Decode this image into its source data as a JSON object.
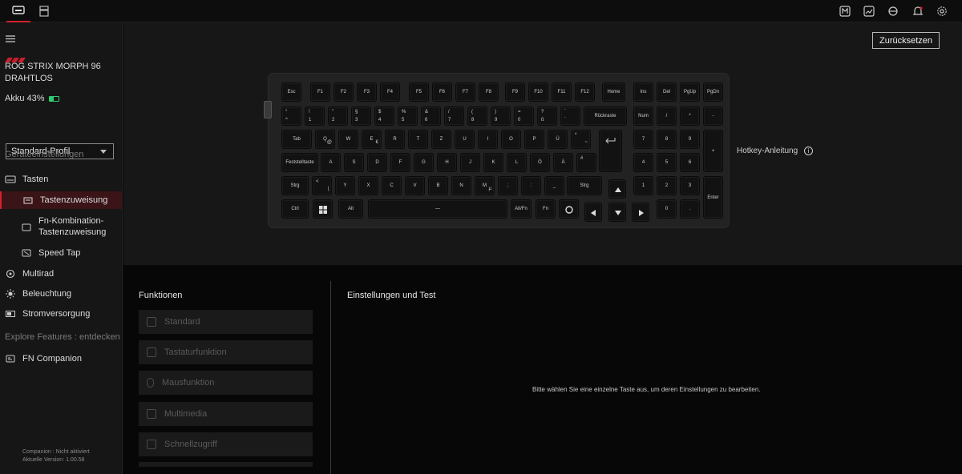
{
  "topbar": {
    "left_icons": [
      "keyboard-device-icon",
      "storage-icon"
    ],
    "right_icons": [
      "m-icon",
      "image-icon",
      "sync-icon",
      "bell-icon",
      "gear-icon"
    ]
  },
  "sidebar": {
    "device_name_line1": "ROG STRIX MORPH 96",
    "device_name_line2": "DRAHTLOS",
    "battery": "Akku 43%",
    "battery_level": 0.43,
    "profile": "Standard-Profil",
    "section_device": "Geräteeinstellungen",
    "items": [
      {
        "label": "Tasten",
        "icon": "keyboard-icon"
      },
      {
        "label": "Tastenzuweisung",
        "icon": "key-assign-icon"
      },
      {
        "label": "Fn-Kombination-",
        "label2": "Tastenzuweisung",
        "icon": "fn-icon"
      },
      {
        "label": "Speed Tap",
        "icon": "speed-tap-icon"
      },
      {
        "label": "Multirad",
        "icon": "wheel-icon"
      },
      {
        "label": "Beleuchtung",
        "icon": "light-icon"
      },
      {
        "label": "Stromversorgung",
        "icon": "battery-icon"
      }
    ],
    "section_explore": "Explore Features",
    "section_explore_link": "entdecken",
    "fn_companion": "FN Companion",
    "footer_line1": "Companion : Nicht aktiviert",
    "footer_line2": "Aktuelle Version: 1.00.58"
  },
  "main": {
    "reset_label": "Zurücksetzen",
    "hotkey_label": "Hotkey-Anleitung",
    "hotkey_info": "i"
  },
  "keyboard": {
    "row0": [
      "Esc",
      "F1",
      "F2",
      "F3",
      "F4",
      "F5",
      "F6",
      "F7",
      "F8",
      "F9",
      "F10",
      "F11",
      "F12",
      "Home",
      "Ins",
      "Del",
      "PgUp",
      "PgDn"
    ],
    "row1": [
      [
        "°",
        "^"
      ],
      [
        "!",
        "1"
      ],
      [
        "\"",
        "2"
      ],
      [
        "§",
        "3"
      ],
      [
        "$",
        "4"
      ],
      [
        "%",
        "5"
      ],
      [
        "&",
        "6"
      ],
      [
        "/",
        "7"
      ],
      [
        "(",
        "8"
      ],
      [
        ")",
        "9"
      ],
      [
        "=",
        "0"
      ],
      [
        "?",
        "ß"
      ],
      [
        "`",
        "´"
      ],
      [
        "",
        "Rückraste"
      ],
      [
        "",
        "Num"
      ],
      [
        "",
        "/"
      ],
      [
        "",
        "*"
      ],
      [
        "",
        "-"
      ]
    ],
    "row2": [
      "Tab",
      "Q",
      "W",
      "E",
      "R",
      "T",
      "Z",
      "U",
      "I",
      "O",
      "P",
      "Ü",
      "*",
      "7",
      "8",
      "9",
      "+"
    ],
    "row3": [
      "Feststelltaste",
      "A",
      "S",
      "D",
      "F",
      "G",
      "H",
      "J",
      "K",
      "L",
      "Ö",
      "Ä",
      "#",
      "4",
      "5",
      "6"
    ],
    "row4": [
      "Strg",
      "<",
      "Y",
      "X",
      "C",
      "V",
      "B",
      "N",
      "M",
      ";",
      ":",
      "_",
      "Strg",
      "1",
      "2",
      "3",
      "Enter"
    ],
    "row5": [
      "Ctrl",
      "",
      "Alt",
      "—",
      "Alt/Fn",
      "Fn",
      "",
      "0",
      "."
    ],
    "sublabels": {
      "q": "@",
      "e": "€",
      "m": "µ",
      "lt": "|",
      "plus": "~"
    }
  },
  "functions": {
    "title": "Funktionen",
    "items": [
      {
        "label": "Standard",
        "icon": "standard-icon"
      },
      {
        "label": "Tastaturfunktion",
        "icon": "keyboard-func-icon"
      },
      {
        "label": "Mausfunktion",
        "icon": "mouse-icon"
      },
      {
        "label": "Multimedia",
        "icon": "multimedia-icon"
      },
      {
        "label": "Schnellzugriff",
        "icon": "shortcut-icon"
      }
    ]
  },
  "settings": {
    "title": "Einstellungen und Test",
    "hint": "Bitte wählen Sie eine einzelne Taste aus, um deren Einstellungen zu bearbeiten."
  },
  "colors": {
    "accent": "#d2212e",
    "panel": "#171717",
    "sidebar": "#161616",
    "battery": "#2ecc71"
  }
}
